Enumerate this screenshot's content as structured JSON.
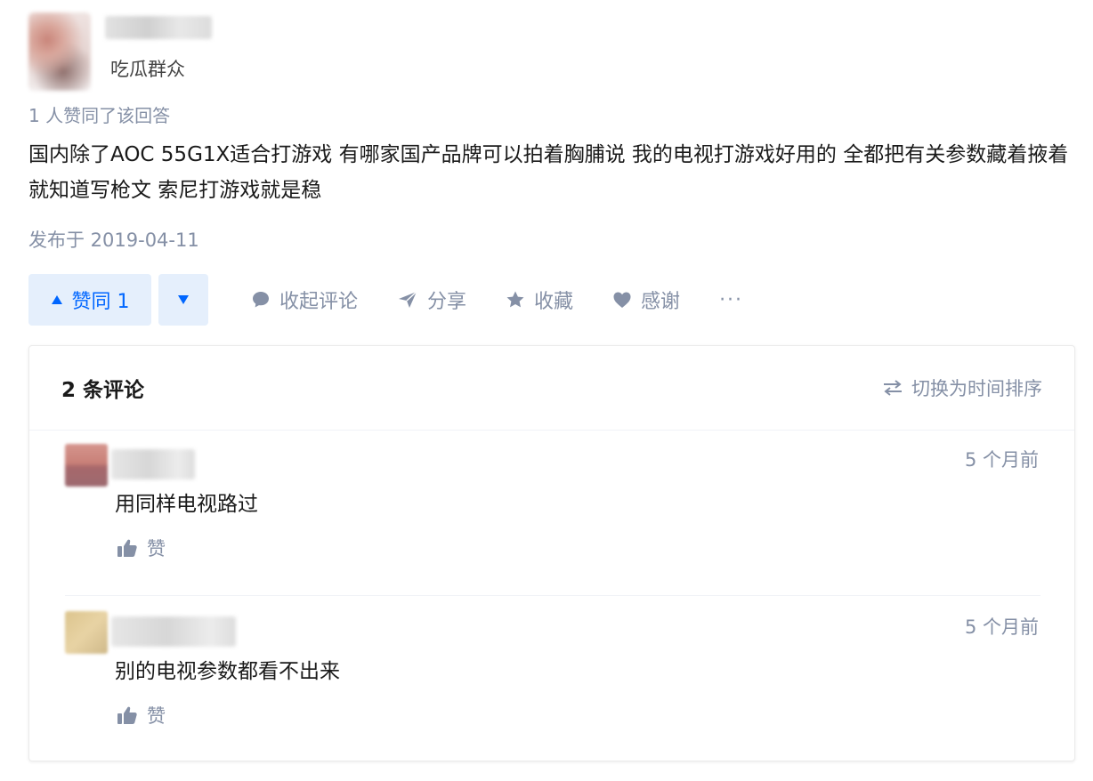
{
  "author": {
    "headline": "吃瓜群众"
  },
  "answer": {
    "vote_summary": "1 人赞同了该回答",
    "content": "国内除了AOC 55G1X适合打游戏 有哪家国产品牌可以拍着胸脯说 我的电视打游戏好用的 全都把有关参数藏着掖着 就知道写枪文 索尼打游戏就是稳",
    "published": "发布于 2019-04-11"
  },
  "actions": {
    "upvote_label": "赞同 1",
    "upvote_icon": "triangle-up-icon",
    "downvote_icon": "triangle-down-icon",
    "collapse_comments": "收起评论",
    "share": "分享",
    "favorite": "收藏",
    "thanks": "感谢",
    "more": "···"
  },
  "comments": {
    "count_label": "2 条评论",
    "sort_label": "切换为时间排序",
    "items": [
      {
        "time": "5 个月前",
        "text": "用同样电视路过",
        "like_label": "赞"
      },
      {
        "time": "5 个月前",
        "text": "别的电视参数都看不出来",
        "like_label": "赞"
      }
    ]
  },
  "colors": {
    "brand_blue": "#0066ff",
    "upvote_bg": "#e5effc",
    "muted_text": "#8590a6",
    "body_text": "#1a1a1a"
  }
}
